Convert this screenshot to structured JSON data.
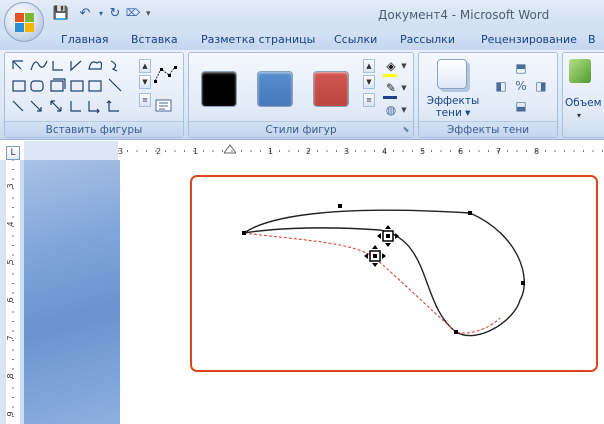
{
  "window": {
    "title": "Документ4 - Microsoft Word"
  },
  "quick_access": {
    "save_icon": "save-icon",
    "undo_icon": "undo-icon",
    "redo_icon": "redo-icon",
    "customize_icon": "qat-customize-icon"
  },
  "tabs": [
    {
      "label": "Главная"
    },
    {
      "label": "Вставка"
    },
    {
      "label": "Разметка страницы"
    },
    {
      "label": "Ссылки"
    },
    {
      "label": "Рассылки"
    },
    {
      "label": "Рецензирование"
    },
    {
      "label": "В"
    }
  ],
  "groups": {
    "insert_shapes": {
      "label": "Вставить фигуры"
    },
    "shape_styles": {
      "label": "Стили фигур",
      "swatches": [
        "#000000",
        "#4f81bd",
        "#c0504d"
      ]
    },
    "shadow_effects": {
      "label": "Эффекты тени",
      "button_label_1": "Эффекты",
      "button_label_2": "тени"
    },
    "volume": {
      "label": "Объем"
    }
  },
  "ruler": {
    "horizontal_ticks": [
      "3",
      "2",
      "1",
      "1",
      "2",
      "3",
      "4",
      "5",
      "6",
      "7",
      "8"
    ],
    "vertical_ticks": [
      "3",
      "4",
      "5",
      "6",
      "7",
      "8",
      "9"
    ]
  },
  "colors": {
    "selection_border": "#d9481c",
    "curve": "#222222",
    "preview": "#d9483c"
  }
}
